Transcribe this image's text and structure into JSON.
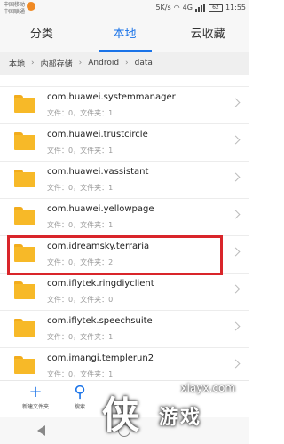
{
  "status_bar": {
    "carrier_1": "中国移动",
    "carrier_2": "中国联通",
    "speed": "5K/s",
    "network": "4G",
    "battery": "62",
    "time": "11:55"
  },
  "tabs": [
    {
      "label": "分类",
      "active": false
    },
    {
      "label": "本地",
      "active": true
    },
    {
      "label": "云收藏",
      "active": false
    }
  ],
  "breadcrumb": [
    "本地",
    "内部存储",
    "Android",
    "data"
  ],
  "folders": [
    {
      "name": "",
      "meta": ""
    },
    {
      "name": "com.huawei.systemmanager",
      "meta": "文件：0，文件夹：1"
    },
    {
      "name": "com.huawei.trustcircle",
      "meta": "文件：0，文件夹：1"
    },
    {
      "name": "com.huawei.vassistant",
      "meta": "文件：0，文件夹：1"
    },
    {
      "name": "com.huawei.yellowpage",
      "meta": "文件：0，文件夹：1"
    },
    {
      "name": "com.idreamsky.terraria",
      "meta": "文件：0，文件夹：2",
      "highlighted": true
    },
    {
      "name": "com.iflytek.ringdiyclient",
      "meta": "文件：0，文件夹：0"
    },
    {
      "name": "com.iflytek.speechsuite",
      "meta": "文件：0，文件夹：1"
    },
    {
      "name": "com.imangi.templerun2",
      "meta": "文件：0，文件夹：1"
    }
  ],
  "bottom_toolbar": {
    "new_folder_label": "新建文件夹",
    "search_label": "搜索"
  },
  "watermark": {
    "url": "xiayx.com",
    "logo": "侠",
    "text": "游戏"
  },
  "colors": {
    "accent": "#1a73e8",
    "folder": "#f7b928",
    "highlight_border": "#d9252a"
  }
}
